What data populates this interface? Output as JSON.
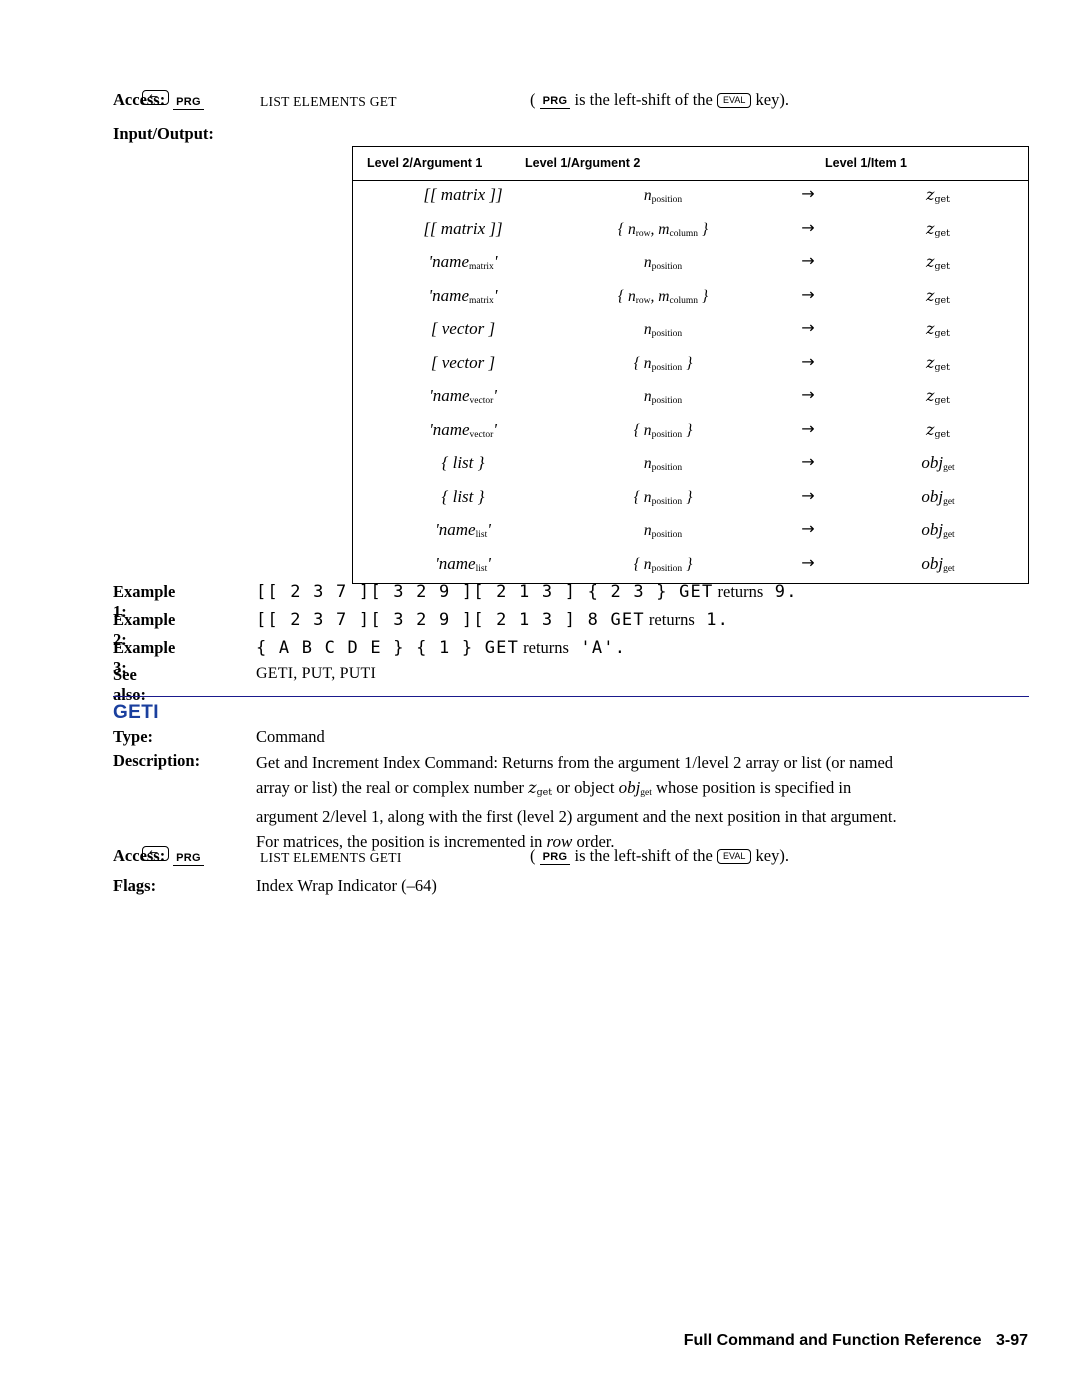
{
  "page": {
    "footer_title": "Full Command and Function Reference",
    "footer_page": "3-97"
  },
  "get_entry": {
    "access_label": "Access:",
    "access_path": "LIST ELEMENTS GET",
    "access_keys": {
      "shift": "left-shift",
      "menu": "PRG"
    },
    "access_note_open": "(",
    "access_note_key": "PRG",
    "access_note_text": "is the left-shift of the",
    "access_note_key2": "EVAL",
    "access_note_end": "key).",
    "io_label": "Input/Output:",
    "table": {
      "headers": [
        "Level 2/Argument 1",
        "Level 1/Argument 2",
        "Level 1/Item 1"
      ],
      "arrow": "→",
      "rows": [
        {
          "arg1": "[[ matrix ]]",
          "arg1_style": "matrix",
          "arg2": "n_position",
          "result": "z_get"
        },
        {
          "arg1": "[[ matrix ]]",
          "arg1_style": "matrix",
          "arg2": "{ n_row, m_column }",
          "result": "z_get"
        },
        {
          "arg1": "'name_matrix'",
          "arg1_style": "name",
          "arg2": "n_position",
          "result": "z_get"
        },
        {
          "arg1": "'name_matrix'",
          "arg1_style": "name",
          "arg2": "{ n_row, m_column }",
          "result": "z_get"
        },
        {
          "arg1": "[ vector ]",
          "arg1_style": "vector",
          "arg2": "n_position",
          "result": "z_get"
        },
        {
          "arg1": "[ vector ]",
          "arg1_style": "vector",
          "arg2": "{ n_position }",
          "result": "z_get"
        },
        {
          "arg1": "'name_vector'",
          "arg1_style": "name",
          "arg2": "n_position",
          "result": "z_get"
        },
        {
          "arg1": "'name_vector'",
          "arg1_style": "name",
          "arg2": "{ n_position }",
          "result": "z_get"
        },
        {
          "arg1": "{ list }",
          "arg1_style": "list",
          "arg2": "n_position",
          "result": "obj_get"
        },
        {
          "arg1": "{ list }",
          "arg1_style": "list",
          "arg2": "{ n_position }",
          "result": "obj_get"
        },
        {
          "arg1": "'name_list'",
          "arg1_style": "name",
          "arg2": "n_position",
          "result": "obj_get"
        },
        {
          "arg1": "'name_list'",
          "arg1_style": "name",
          "arg2": "{ n_position }",
          "result": "obj_get"
        }
      ]
    },
    "examples": [
      {
        "label": "Example 1:",
        "code": "[[ 2 3 7 ][ 3 2 9 ][ 2 1 3 ] { 2 3 } GET",
        "returns": "returns",
        "result": "9."
      },
      {
        "label": "Example 2:",
        "code": "[[ 2 3 7 ][ 3 2 9 ][ 2 1 3 ] 8 GET",
        "returns": "returns",
        "result": "1."
      },
      {
        "label": "Example 3:",
        "code": "{ A B C D E } { 1 } GET",
        "returns": "returns",
        "result": "'A'."
      }
    ],
    "see_also_label": "See also:",
    "see_also_value": "GETI, PUT, PUTI"
  },
  "geti_entry": {
    "title": "GETI",
    "type_label": "Type:",
    "type_value": "Command",
    "description_label": "Description:",
    "description": "Get and Increment Index Command: Returns from the argument 1/level 2 array or list (or named array or list) the real or complex number z_get or object obj_get whose position is specified in argument 2/level 1, along with the first (level 2) argument and the next position in that argument. For matrices, the position is incremented in row order.",
    "description_lines": [
      "Get and Increment Index Command: Returns from the argument 1/level 2 array or list (or named",
      "array or list) the real or complex number zget or object objget whose position is specified in",
      "argument 2/level 1, along with the first (level 2) argument and the next position in that argument.",
      "For matrices, the position is incremented in row order."
    ],
    "access_label": "Access:",
    "access_path": "LIST ELEMENTS GETI",
    "access_note_open": "(",
    "access_note_key": "PRG",
    "access_note_text": "is the left-shift of the",
    "access_note_key2": "EVAL",
    "access_note_end": "key).",
    "flags_label": "Flags:",
    "flags_value": "Index Wrap Indicator (–64)"
  }
}
